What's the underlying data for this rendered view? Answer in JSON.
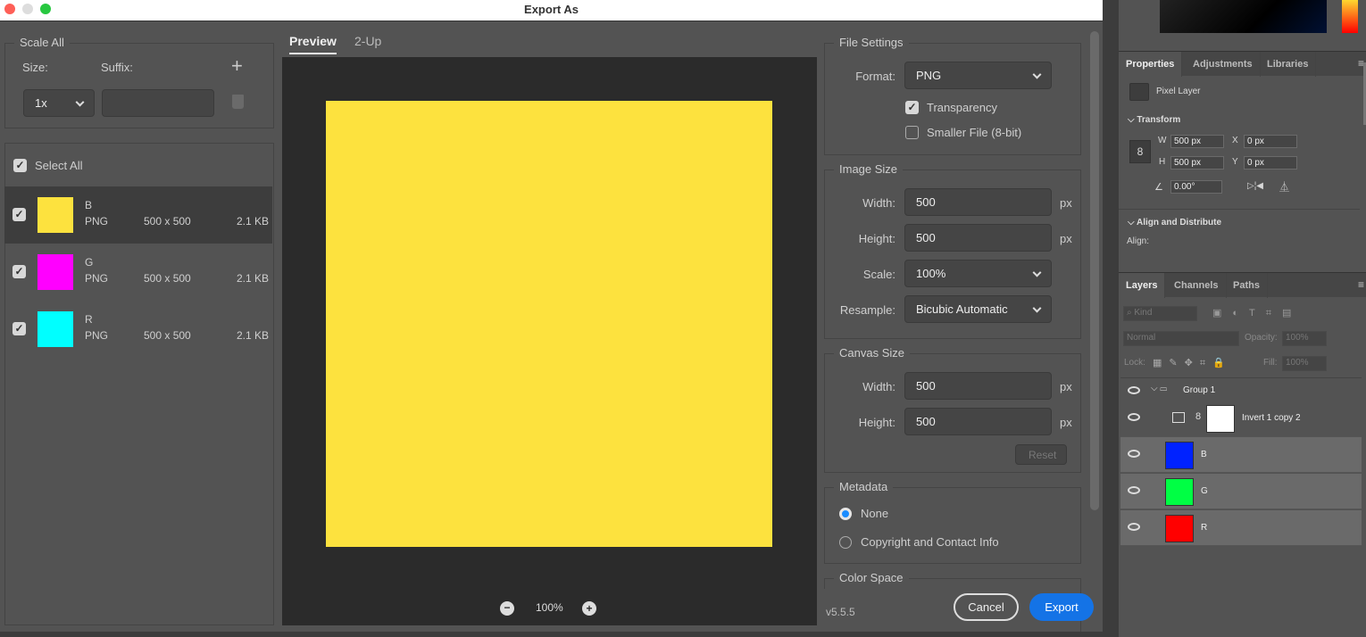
{
  "dialog": {
    "title": "Export As",
    "version": "v5.5.5",
    "cancel": "Cancel",
    "export": "Export"
  },
  "scale_all": {
    "legend": "Scale All",
    "size_label": "Size:",
    "suffix_label": "Suffix:",
    "size_value": "1x",
    "suffix_value": ""
  },
  "assets": {
    "select_all": "Select All",
    "items": [
      {
        "name": "B",
        "format": "PNG",
        "dims": "500 x 500",
        "size": "2.1 KB",
        "color": "#fde23e",
        "checked": true,
        "selected": true
      },
      {
        "name": "G",
        "format": "PNG",
        "dims": "500 x 500",
        "size": "2.1 KB",
        "color": "#ff00ff",
        "checked": true,
        "selected": false
      },
      {
        "name": "R",
        "format": "PNG",
        "dims": "500 x 500",
        "size": "2.1 KB",
        "color": "#00ffff",
        "checked": true,
        "selected": false
      }
    ]
  },
  "preview": {
    "tabs": [
      "Preview",
      "2-Up"
    ],
    "active_tab": "Preview",
    "zoom": "100%",
    "image_color": "#fde23e"
  },
  "file_settings": {
    "legend": "File Settings",
    "format_label": "Format:",
    "format": "PNG",
    "transparency": "Transparency",
    "transparency_checked": true,
    "smaller_file": "Smaller File (8-bit)",
    "smaller_checked": false
  },
  "image_size": {
    "legend": "Image Size",
    "width_label": "Width:",
    "width": "500",
    "height_label": "Height:",
    "height": "500",
    "scale_label": "Scale:",
    "scale": "100%",
    "resample_label": "Resample:",
    "resample": "Bicubic Automatic",
    "unit": "px"
  },
  "canvas_size": {
    "legend": "Canvas Size",
    "width_label": "Width:",
    "width": "500",
    "height_label": "Height:",
    "height": "500",
    "unit": "px",
    "reset": "Reset"
  },
  "metadata": {
    "legend": "Metadata",
    "options": [
      "None",
      "Copyright and Contact Info"
    ],
    "selected": "None"
  },
  "color_space": {
    "legend": "Color Space"
  },
  "properties": {
    "tabs": [
      "Properties",
      "Adjustments",
      "Libraries"
    ],
    "layer_type": "Pixel Layer",
    "transform": "Transform",
    "w_label": "W",
    "w": "500 px",
    "h_label": "H",
    "h": "500 px",
    "x_label": "X",
    "x": "0 px",
    "y_label": "Y",
    "y": "0 px",
    "angle": "0.00°",
    "align_distribute": "Align and Distribute",
    "align": "Align:"
  },
  "layers": {
    "tabs": [
      "Layers",
      "Channels",
      "Paths"
    ],
    "kind": "Kind",
    "blend": "Normal",
    "opacity_label": "Opacity:",
    "opacity": "100%",
    "lock_label": "Lock:",
    "fill_label": "Fill:",
    "fill": "100%",
    "items": [
      {
        "name": "Group 1"
      },
      {
        "name": "Invert 1 copy 2",
        "color": "#ffffff"
      },
      {
        "name": "B",
        "color": "#0022ff"
      },
      {
        "name": "G",
        "color": "#00ff44"
      },
      {
        "name": "R",
        "color": "#ff0000"
      }
    ]
  }
}
